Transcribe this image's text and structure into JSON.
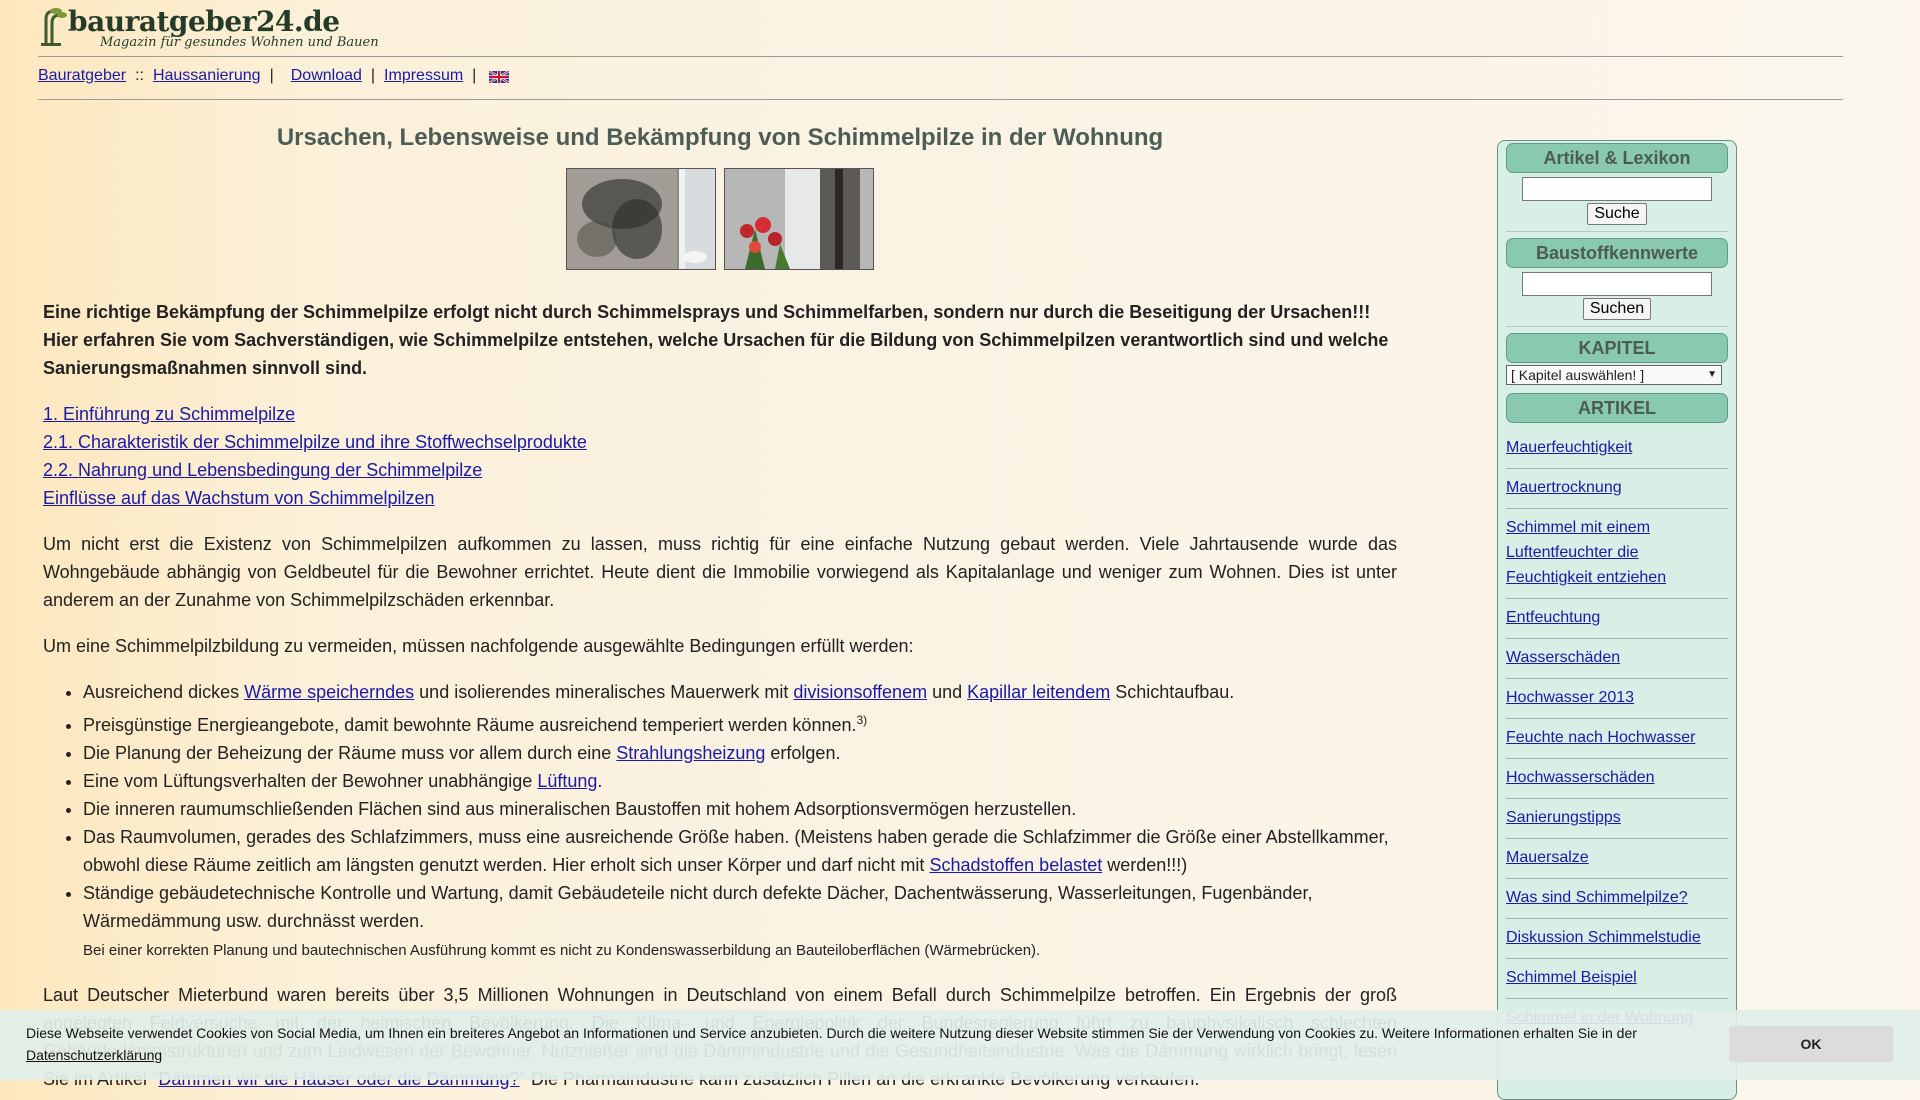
{
  "header": {
    "logo_name": "bauratgeber24.de",
    "logo_tagline": "Magazin für gesundes Wohnen und Bauen"
  },
  "nav": {
    "items": [
      "Bauratgeber",
      "Haussanierung",
      "Download",
      "Impressum"
    ],
    "sep_double": "::",
    "sep_pipe": "|"
  },
  "main": {
    "title": "Ursachen, Lebensweise und Bekämpfung von Schimmelpilze in der Wohnung",
    "intro_1": "Eine richtige Bekämpfung der Schimmelpilze erfolgt nicht durch Schimmelsprays und Schimmelfarben, sondern nur durch die Beseitigung der Ursachen!!!",
    "intro_2": "Hier erfahren Sie vom Sachverständigen, wie Schimmelpilze entstehen, welche Ursachen für die Bildung von Schimmelpilzen verantwortlich sind und welche Sanierungsmaßnahmen sinnvoll sind.",
    "toc": [
      "1. Einführung zu Schimmelpilze",
      "2.1. Charakteristik der Schimmelpilze und ihre Stoffwechselprodukte",
      "2.2. Nahrung und Lebensbedingung der Schimmelpilze",
      "Einflüsse auf das Wachstum von Schimmelpilzen"
    ],
    "para_1": "Um nicht erst die Existenz von Schimmelpilzen aufkommen zu lassen, muss richtig für eine einfache Nutzung gebaut werden. Viele Jahrtausende wurde das Wohngebäude abhängig von Geldbeutel für die Bewohner errichtet. Heute dient die Immobilie vorwiegend als Kapitalanlage und weniger zum Wohnen. Dies ist unter anderem an der Zunahme von Schimmelpilzschäden erkennbar.",
    "para_2": "Um eine Schimmelpilzbildung zu vermeiden, müssen nachfolgende ausgewählte Bedingungen erfüllt werden:",
    "list": {
      "i1_a": "Ausreichend dickes ",
      "i1_l1": "Wärme speicherndes",
      "i1_b": " und isolierendes mineralisches Mauerwerk mit ",
      "i1_l2": "divisionsoffenem",
      "i1_c": " und ",
      "i1_l3": "Kapillar leitendem",
      "i1_d": " Schichtaufbau.",
      "i2": "Preisgünstige Energieangebote, damit bewohnte Räume ausreichend temperiert werden können.",
      "i2_sup": "3)",
      "i3_a": "Die Planung der Beheizung der Räume muss vor allem durch eine ",
      "i3_l": "Strahlungsheizung",
      "i3_b": " erfolgen.",
      "i4_a": "Eine vom Lüftungsverhalten der Bewohner unabhängige ",
      "i4_l": "Lüftung",
      "i4_b": ".",
      "i5": "Die inneren raumumschließenden Flächen sind aus mineralischen Baustoffen mit hohem Adsorptionsvermögen herzustellen.",
      "i6_a": "Das Raumvolumen, gerades des Schlafzimmers, muss eine ausreichende Größe haben. (Meistens haben gerade die Schlafzimmer die Größe einer Abstellkammer, obwohl diese Räume zeitlich am längsten genutzt werden. Hier erholt sich unser Körper und darf nicht mit ",
      "i6_l": "Schadstoffen belastet",
      "i6_b": " werden!!!)",
      "i7": "Ständige gebäudetechnische Kontrolle und Wartung, damit Gebäudeteile nicht durch defekte Dächer, Dachentwässerung, Wasserleitungen, Fugenbänder, Wärmedämmung usw. durchnässt werden.",
      "i7_note": "Bei einer korrekten Planung und bautechnischen Ausführung kommt es nicht zu Kondenswasserbildung an Bauteiloberflächen (Wärmebrücken)."
    },
    "para_3_a": "Laut Deutscher Mieterbund waren bereits über 3,5 Millionen Wohnungen in Deutschland von einem Befall durch Schimmelpilze betroffen. Ein Ergebnis der groß angelegten Feldversuche mit der heimischen Bevölkerung. Die Klima- und Energiepolitik der Bundesregierung führt zu bauphysikalisch schlechten Gebäudedämmstrukturen und zum Leidwesen der Bewohner. Nutznießer sind die Dämmindustrie und die Gesundheitsindustrie. Was die Dämmung wirklich bringt, lesen Sie im Artikel \"",
    "para_3_link": "Dämmen wir die Häuser oder die Dämmung?",
    "para_3_b": "\" Die Pharmaindustrie kann zusätzlich Pillen an die erkrankte Bevölkerung verkaufen."
  },
  "sidebar": {
    "search_title": "Artikel & Lexikon",
    "search_button": "Suche",
    "baustoff_title": "Baustoffkennwerte",
    "baustoff_button": "Suchen",
    "kapitel_title": "KAPITEL",
    "kapitel_select": "[ Kapitel auswählen! ]",
    "artikel_title": "ARTIKEL",
    "articles": [
      "Mauerfeuchtigkeit",
      "Mauertrocknung",
      "Schimmel mit einem Luftentfeuchter die Feuchtigkeit entziehen",
      "Entfeuchtung",
      "Wasserschäden",
      "Hochwasser 2013",
      "Feuchte nach Hochwasser",
      "Hochwasserschäden",
      "Sanierungstipps",
      "Mauersalze",
      "Was sind Schimmelpilze?",
      "Diskussion Schimmelstudie",
      "Schimmel Beispiel",
      "Schimmel in der Wohnung"
    ]
  },
  "cookie": {
    "text": "Diese Webseite verwendet Cookies von Social Media, um Ihnen ein breiteres Angebot an Informationen und Service anzubieten. Durch die weitere Nutzung dieser Website stimmen Sie der Verwendung von Cookies zu. Weitere Informationen erhalten Sie in der",
    "link": "Datenschutzerklärung",
    "ok": "OK"
  },
  "colors": {
    "link": "#1a1aa6",
    "title": "#4d5d56",
    "sidebar_bg": "#d8efe6",
    "sidebar_header": "#88c9b0"
  }
}
